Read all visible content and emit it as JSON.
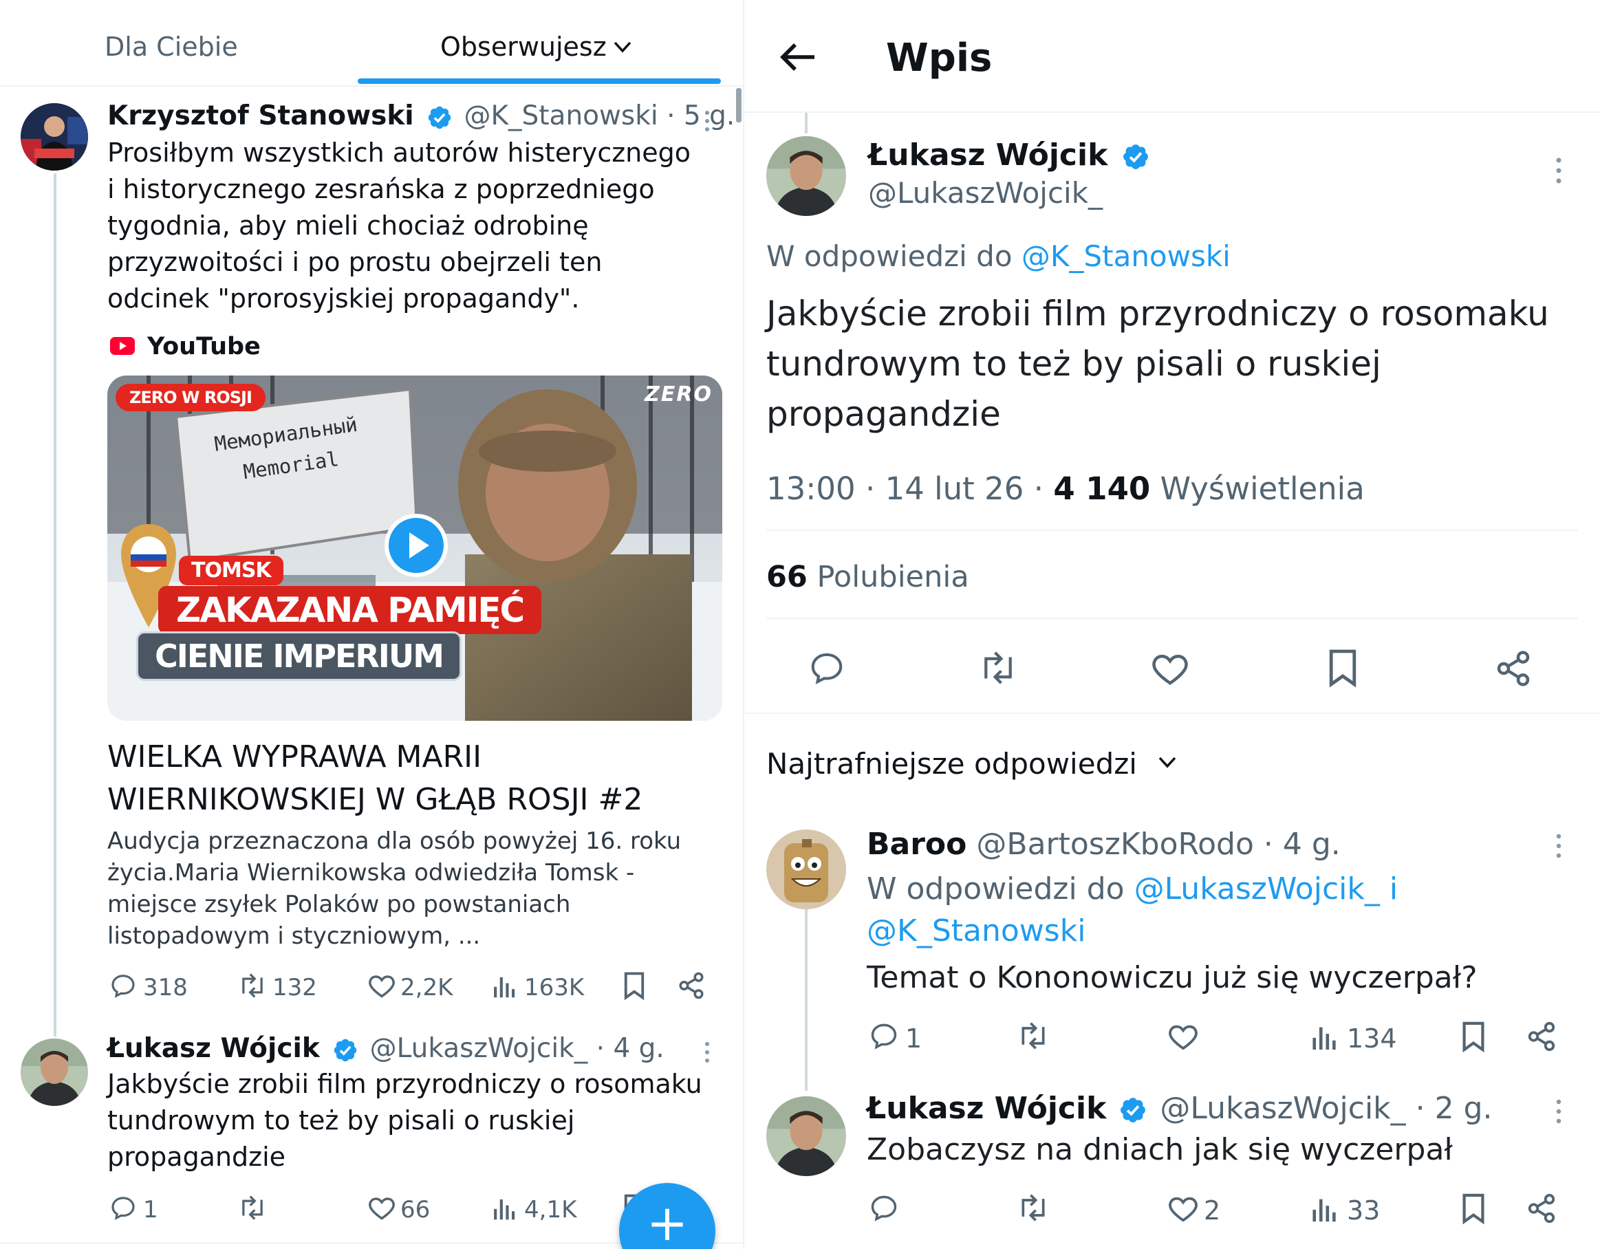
{
  "feed": {
    "tabs": [
      {
        "label": "Dla Ciebie"
      },
      {
        "label": "Obserwujesz"
      }
    ],
    "tweet1": {
      "name": "Krzysztof Stanowski",
      "handle": "@K_Stanowski",
      "time": "· 5 g.",
      "text": "Prosiłbym wszystkich autorów histerycznego i historycznego zesrańska z poprzedniego tygodnia, aby mieli chociaż odrobinę przyzwoitości i po prostu obejrzeli ten odcinek \"prorosyjskiej propagandy\".",
      "source": "YouTube",
      "card": {
        "badge": "ZERO W ROSJI",
        "logo": "ZERO",
        "sign_ru": "Мемориальный",
        "sign_en": "Memorial",
        "tag": "TOMSK",
        "headline": "ZAKAZANA PAMIĘĆ",
        "subhead": "CIENIE IMPERIUM",
        "title": "WIELKA WYPRAWA MARII WIERNIKOWSKIEJ W GŁĄB ROSJI #2",
        "description": "Audycja przeznaczona dla osób powyżej 16. roku życia.Maria Wiernikowska odwiedziła Tomsk - miejsce zsyłek Polaków po powstaniach listopadowym i styczniowym, ..."
      },
      "stats": {
        "replies": "318",
        "retweets": "132",
        "likes": "2,2K",
        "views": "163K"
      }
    },
    "tweet2": {
      "name": "Łukasz Wójcik",
      "handle": "@LukaszWojcik_",
      "time": "· 4 g.",
      "text": "Jakbyście zrobii film przyrodniczy o rosomaku tundrowym to też by pisali o ruskiej propagandzie",
      "stats": {
        "replies": "1",
        "retweets": "",
        "likes": "66",
        "views": "4,1K"
      }
    },
    "fab_label": "+"
  },
  "detail": {
    "title": "Wpis",
    "author": {
      "name": "Łukasz Wójcik",
      "handle": "@LukaszWojcik_"
    },
    "reply_to_prefix": "W odpowiedzi do",
    "reply_to_handle": "@K_Stanowski",
    "text": "Jakbyście zrobii film przyrodniczy o rosomaku tundrowym to też by pisali o ruskiej propagandzie",
    "time": "13:00 · 14 lut 26 ·",
    "views_count": "4 140",
    "views_label": "Wyświetlenia",
    "likes_count": "66",
    "likes_label": "Polubienia",
    "replies_sort": "Najtrafniejsze odpowiedzi",
    "replies": [
      {
        "name": "Baroo",
        "handle": "@BartoszKboRodo",
        "time": "· 4 g.",
        "reply_prefix": "W odpowiedzi do",
        "reply_handle1": "@LukaszWojcik_",
        "reply_and": "i",
        "reply_handle2": "@K_Stanowski",
        "text": "Temat o Kononowiczu już się wyczerpał?",
        "stats": {
          "replies": "1",
          "retweets": "",
          "likes": "",
          "views": "134"
        }
      },
      {
        "name": "Łukasz Wójcik",
        "handle": "@LukaszWojcik_",
        "time": "· 2 g.",
        "text": "Zobaczysz na dniach jak się wyczerpał",
        "stats": {
          "replies": "",
          "retweets": "",
          "likes": "2",
          "views": "33"
        }
      }
    ]
  },
  "colors": {
    "accent": "#1d9bf0",
    "text": "#0f1419",
    "muted": "#536471",
    "divider": "#eff3f4",
    "youtube_red": "#ff0033"
  }
}
